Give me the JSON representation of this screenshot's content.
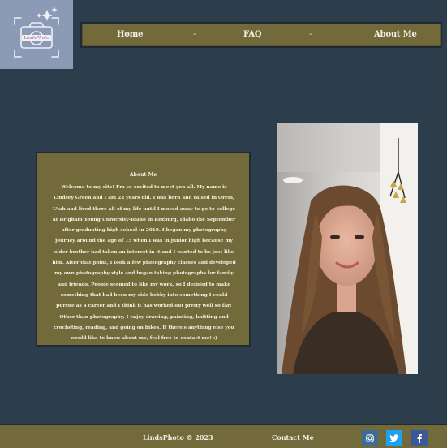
{
  "logo": {
    "text": "LindsPhoto"
  },
  "nav": {
    "home": "Home",
    "sep1": "-",
    "faq": "FAQ",
    "sep2": "-",
    "about": "About Me"
  },
  "about": {
    "title": "About Me",
    "body": "Welcome to my site! I'm so excited to meet you all. My name is Lindsey Green and I am 22 years old. I was born and raised in Orem, Utah and lived there all of my life until I moved away to go to college at Brigham Young University-Idaho in Rexburg, Idaho the September after graduating high school in 2019. I began my photography journey around the age of 15 when I was in junior high because my older brother had taken an interest in it and I wanted to be just like him. After that point, I took a few photography classes and developed my own photography style and began taking photographs for family and friends. People seemed to like my work, so I decided to make something that had been my side hobby into something I could pursue as a career and I think it has worked out pretty well so far! Other than photography, I enjoy drawing, painting, knitting and crocheting, reading, and going on hikes. If there's anything else you would like to know about me, feel free to contact me! :)"
  },
  "footer": {
    "copyright": "LindsPhoto © 2023",
    "contact": "Contact Me",
    "social": [
      "instagram-icon",
      "twitter-icon",
      "facebook-icon"
    ]
  },
  "colors": {
    "background": "#2c3e4b",
    "panel": "#736a3b",
    "logo_bg": "#8c9bb5"
  }
}
